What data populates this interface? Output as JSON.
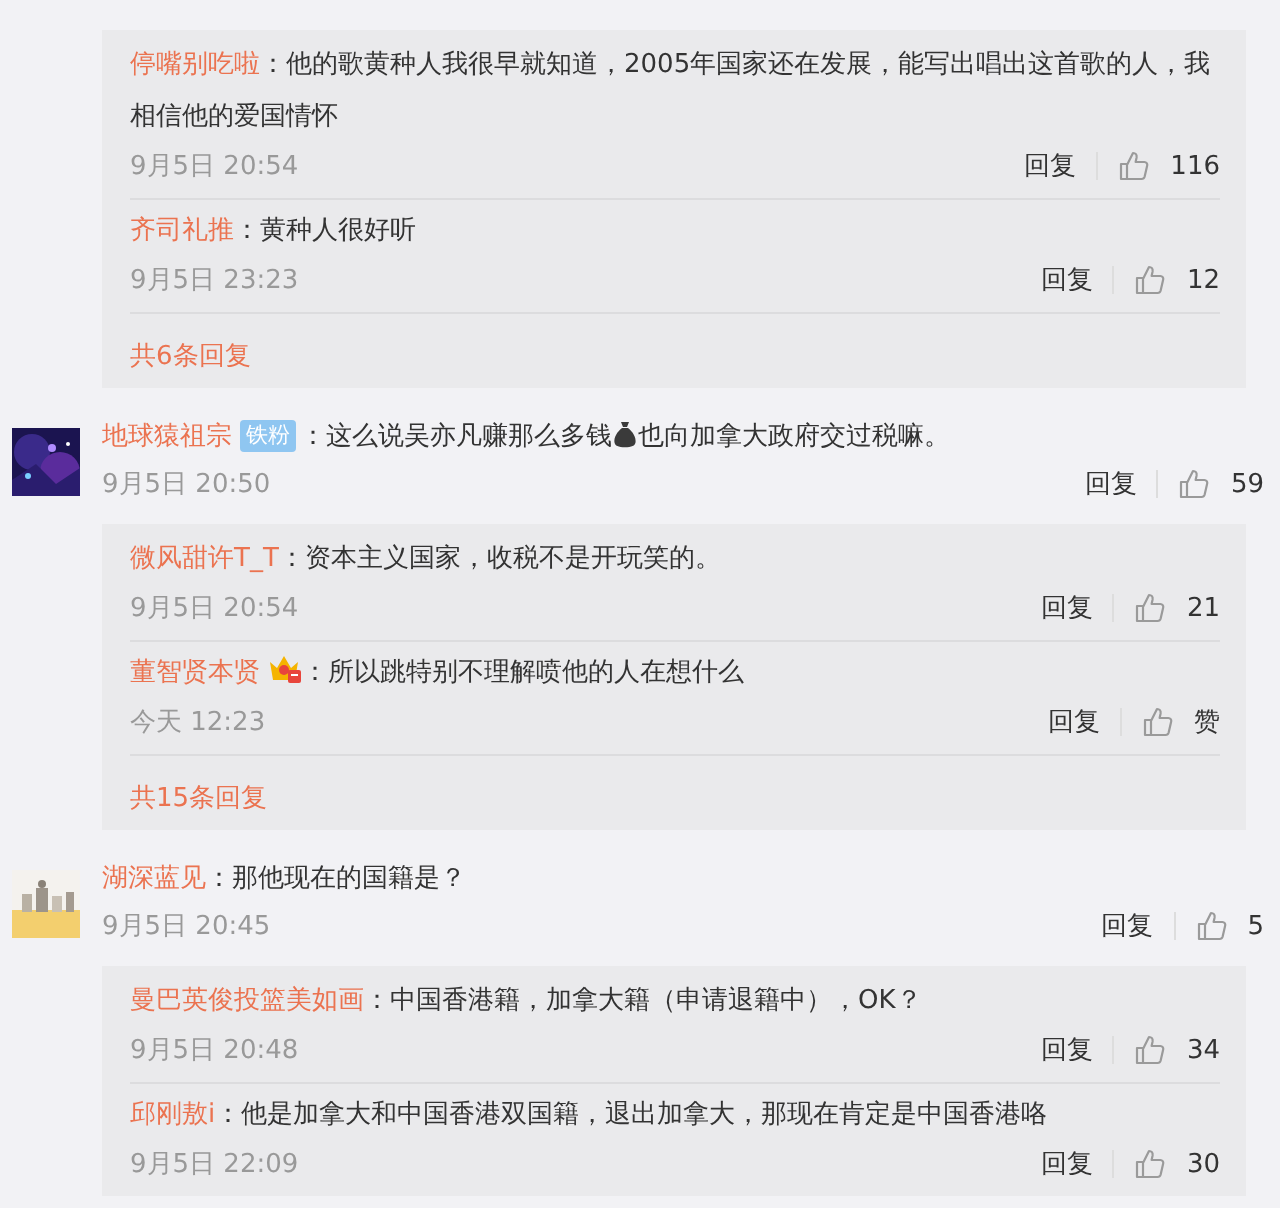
{
  "threads": [
    {
      "replies": [
        {
          "user": "停嘴别吃啦",
          "segments": [
            {
              "kind": "text",
              "text": "：他的歌黄种人我很早就知道，2005年国家还在发展，能写出唱出这首歌的人，我相信他的爱国情怀"
            }
          ],
          "time": "9月5日 20:54",
          "reply": "回复",
          "likes": "116"
        },
        {
          "user": "齐司礼推",
          "segments": [
            {
              "kind": "text",
              "text": "：黄种人很好听"
            }
          ],
          "time": "9月5日 23:23",
          "reply": "回复",
          "likes": "12"
        }
      ],
      "more": "共6条回复"
    },
    {
      "comment": {
        "user": "地球猿祖宗",
        "badge": {
          "kind": "fan",
          "text": "铁粉"
        },
        "segments": [
          {
            "kind": "text",
            "text": "：这么说吴亦凡赚那么多钱"
          },
          {
            "kind": "money-bag"
          },
          {
            "kind": "text",
            "text": "也向加拿大政府交过税嘛。"
          }
        ],
        "time": "9月5日 20:50",
        "reply": "回复",
        "likes": "59"
      },
      "replies": [
        {
          "user": "微风甜许T_T",
          "segments": [
            {
              "kind": "text",
              "text": "：资本主义国家，收税不是开玩笑的。"
            }
          ],
          "time": "9月5日 20:54",
          "reply": "回复",
          "likes": "21"
        },
        {
          "user": "董智贤本贤",
          "badge": {
            "kind": "crown"
          },
          "segments": [
            {
              "kind": "text",
              "text": "：所以跳特别不理解喷他的人在想什么"
            }
          ],
          "time": "今天 12:23",
          "reply": "回复",
          "likes": "赞"
        }
      ],
      "more": "共15条回复"
    },
    {
      "comment": {
        "user": "湖深蓝见",
        "segments": [
          {
            "kind": "text",
            "text": "：那他现在的国籍是？"
          }
        ],
        "time": "9月5日 20:45",
        "reply": "回复",
        "likes": "5"
      },
      "replies": [
        {
          "user": "曼巴英俊投篮美如画",
          "segments": [
            {
              "kind": "text",
              "text": "：中国香港籍，加拿大籍（申请退籍中），OK？"
            }
          ],
          "time": "9月5日 20:48",
          "reply": "回复",
          "likes": "34"
        },
        {
          "user": "邱刚敖i",
          "segments": [
            {
              "kind": "text",
              "text": "：他是加拿大和中国香港双国籍，退出加拿大，那现在肯定是中国香港咯"
            }
          ],
          "time": "9月5日 22:09",
          "reply": "回复",
          "likes": "30"
        }
      ]
    }
  ]
}
